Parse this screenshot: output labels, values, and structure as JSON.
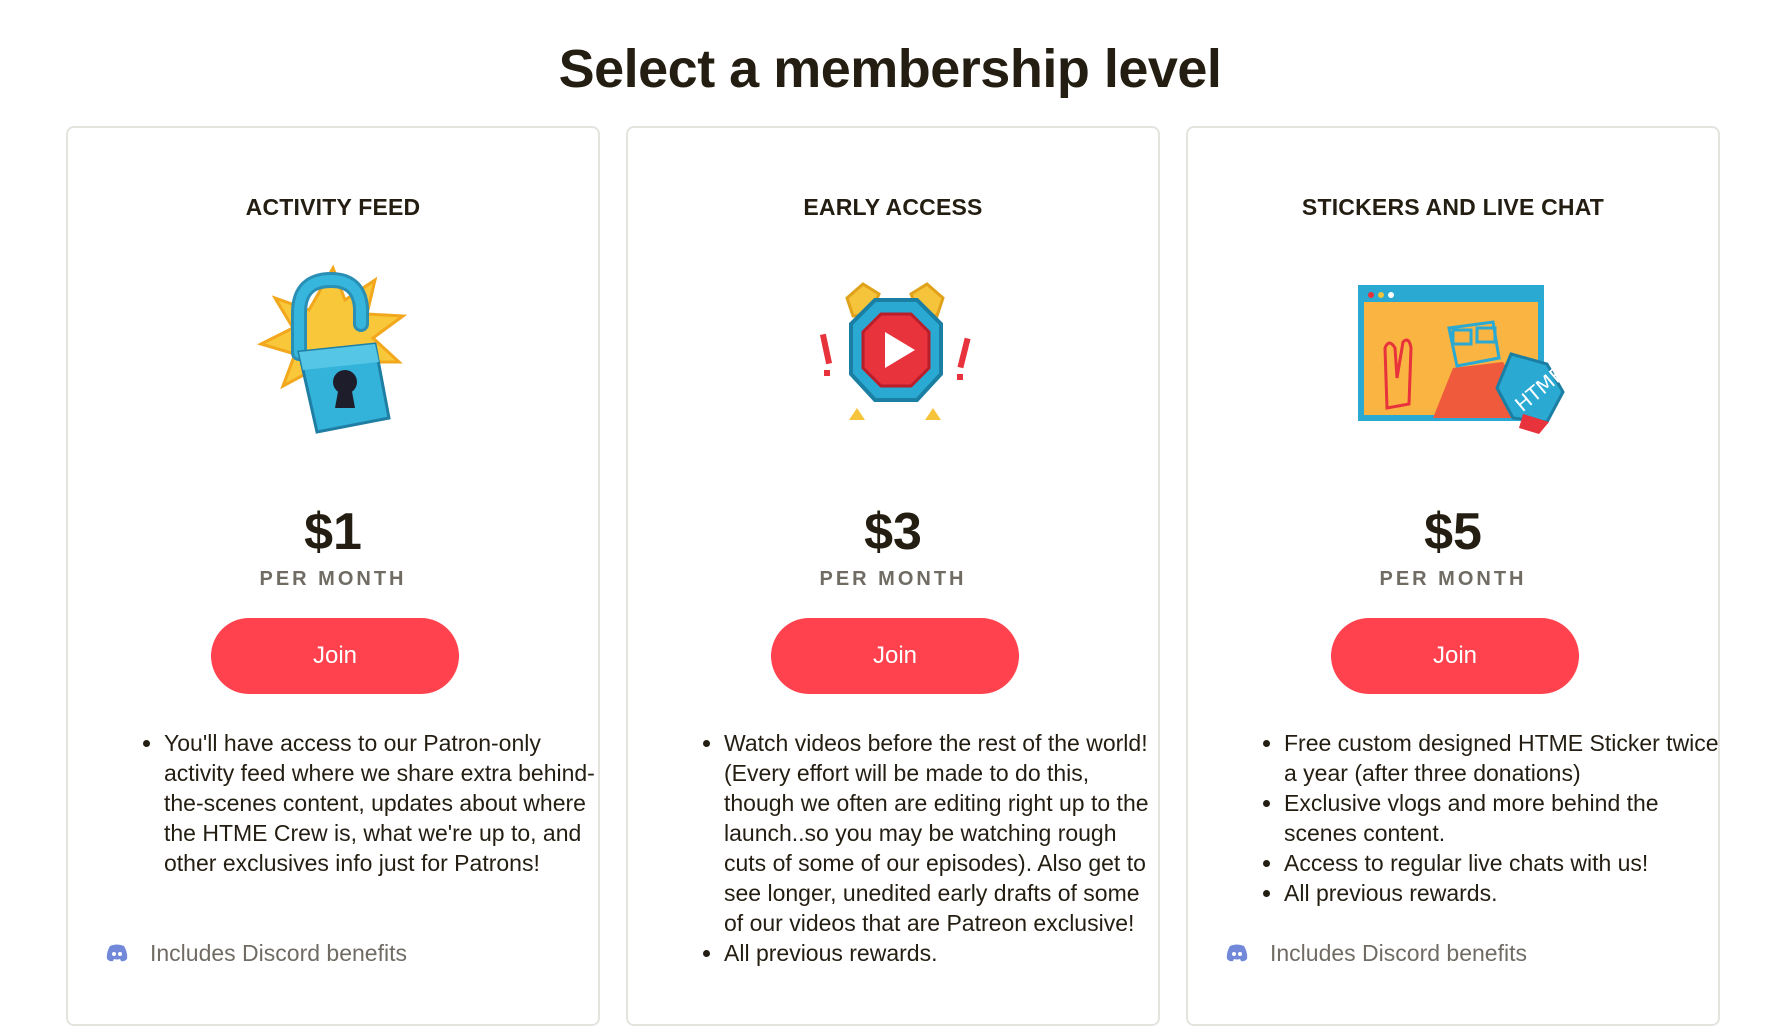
{
  "page": {
    "title": "Select a membership level"
  },
  "tiers": [
    {
      "name": "ACTIVITY FEED",
      "icon": "unlocked-padlock-icon",
      "price": "$1",
      "period": "PER MONTH",
      "join_label": "Join",
      "benefits": [
        "You'll have access to our Patron-only activity feed where we share extra behind-the-scenes content, updates about where the HTME Crew is, what we're up to, and other exclusives info just for Patrons!"
      ],
      "discord_label": "Includes Discord benefits"
    },
    {
      "name": "EARLY ACCESS",
      "icon": "alarm-clock-play-icon",
      "price": "$3",
      "period": "PER MONTH",
      "join_label": "Join",
      "benefits": [
        "Watch videos before the rest of the world! (Every effort will be made to do this, though we often are editing right up to the launch..so you may be watching rough cuts of some of our episodes).  Also get to see longer, unedited early drafts of some of our videos that are Patreon exclusive!",
        "All previous rewards."
      ]
    },
    {
      "name": "STICKERS AND LIVE CHAT",
      "icon": "video-chat-sticker-icon",
      "price": "$5",
      "period": "PER MONTH",
      "join_label": "Join",
      "benefits": [
        "Free custom designed HTME Sticker twice a year (after three donations)",
        "Exclusive vlogs and more behind the scenes content.",
        "Access to regular live chats with us!",
        "All previous rewards."
      ],
      "sticker_text": "HTME",
      "discord_label": "Includes Discord benefits"
    }
  ],
  "colors": {
    "accent": "#ff424d",
    "text": "#241e12",
    "muted": "#706c64",
    "border": "#e5e3dd",
    "discord": "#7289da"
  }
}
